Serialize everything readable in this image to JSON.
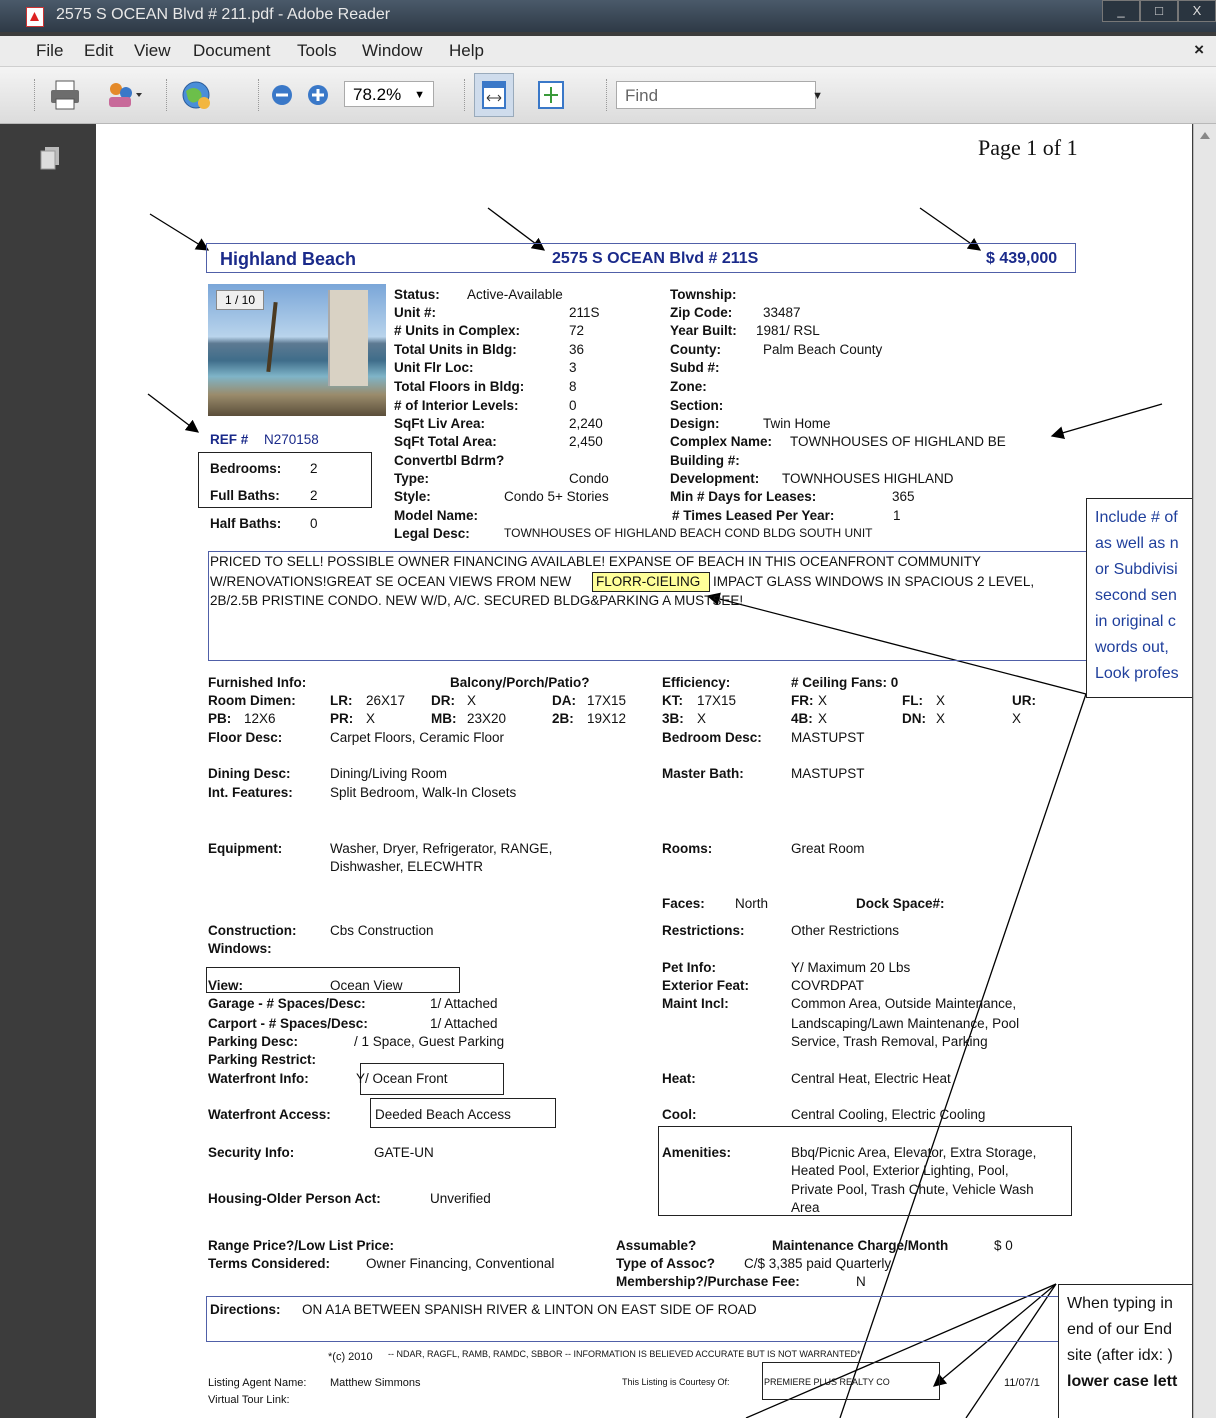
{
  "window": {
    "title": "2575 S OCEAN Blvd # 211.pdf - Adobe Reader",
    "min_label": "_",
    "max_label": "□",
    "close_label": "X"
  },
  "menu": {
    "items": [
      "File",
      "Edit",
      "View",
      "Document",
      "Tools",
      "Window",
      "Help"
    ],
    "close_label": "×"
  },
  "toolbar": {
    "zoom_value": "78.2%",
    "find_placeholder": "Find"
  },
  "icons": [
    "print-icon",
    "share-icon",
    "globe-icon",
    "zoom-out-icon",
    "zoom-in-icon",
    "fit-width-icon",
    "fit-page-icon",
    "pages-icon"
  ],
  "page": {
    "page_label": "Page 1 of 1",
    "header": {
      "city": "Highland Beach",
      "address": "2575 S OCEAN Blvd # 211S",
      "price": "$ 439,000"
    },
    "photo_counter": "1 / 10",
    "ref": {
      "label": "REF #",
      "value": "N270158"
    },
    "rooms": {
      "bed_label": "Bedrooms:",
      "bed_value": "2",
      "fbath_label": "Full Baths:",
      "fbath_value": "2",
      "hbath_label": "Half Baths:",
      "hbath_value": "0"
    },
    "left_fields": [
      {
        "label": "Status:",
        "value": "Active-Available"
      },
      {
        "label": "Unit #:",
        "value": "211S"
      },
      {
        "label": "# Units in Complex:",
        "value": "72"
      },
      {
        "label": "Total Units in Bldg:",
        "value": "36"
      },
      {
        "label": "Unit Flr Loc:",
        "value": "3"
      },
      {
        "label": "Total Floors in Bldg:",
        "value": "8"
      },
      {
        "label": "# of Interior Levels:",
        "value": "0"
      },
      {
        "label": "SqFt Liv Area:",
        "value": "2,240"
      },
      {
        "label": "SqFt Total Area:",
        "value": "2,450"
      },
      {
        "label": "Convertbl Bdrm?",
        "value": ""
      },
      {
        "label": "Type:",
        "value": "Condo"
      },
      {
        "label": "Style:",
        "value": "Condo 5+ Stories"
      },
      {
        "label": "Model Name:",
        "value": ""
      },
      {
        "label": "Legal Desc:",
        "value": "TOWNHOUSES OF HIGHLAND BEACH COND BLDG SOUTH UNIT"
      }
    ],
    "right_fields": [
      {
        "label": "Township:",
        "value": ""
      },
      {
        "label": "Zip Code:",
        "value": "33487"
      },
      {
        "label": "Year Built:",
        "value": "1981/ RSL"
      },
      {
        "label": "County:",
        "value": "Palm Beach County"
      },
      {
        "label": "Subd #:",
        "value": ""
      },
      {
        "label": "Zone:",
        "value": ""
      },
      {
        "label": "Section:",
        "value": ""
      },
      {
        "label": "Design:",
        "value": "Twin Home"
      },
      {
        "label": "Complex Name:",
        "value": "TOWNHOUSES OF HIGHLAND BE"
      },
      {
        "label": "Building #:",
        "value": ""
      },
      {
        "label": "Development:",
        "value": "TOWNHOUSES HIGHLAND"
      },
      {
        "label": "Min # Days for Leases:",
        "value": "365"
      },
      {
        "label": "# Times Leased Per Year:",
        "value": "1"
      }
    ],
    "remarks": {
      "line1": "PRICED TO SELL! POSSIBLE OWNER FINANCING AVAILABLE! EXPANSE OF BEACH IN THIS OCEANFRONT COMMUNITY",
      "line2a": "W/RENOVATIONS!GREAT SE OCEAN VIEWS FROM NEW",
      "line2hl": "FLORR-CIELING",
      "line2b": "IMPACT GLASS WINDOWS IN SPACIOUS 2 LEVEL,",
      "line3": "2B/2.5B PRISTINE CONDO. NEW W/D, A/C. SECURED BLDG&PARKING A MUSTSEE!"
    },
    "details": {
      "furnished": "Furnished Info:",
      "balcony": "Balcony/Porch/Patio?",
      "efficiency": "Efficiency:",
      "ceiling_fans": "# Ceiling Fans: 0",
      "room_dimen": "Room Dimen:",
      "lr": "LR:",
      "lr_v": "26X17",
      "dr": "DR:",
      "dr_v": "X",
      "da": "DA:",
      "da_v": "17X15",
      "kt": "KT:",
      "kt_v": "17X15",
      "fr": "FR:",
      "fr_v": "X",
      "fl": "FL:",
      "fl_v": "X",
      "ur": "UR:",
      "ur_v": "X",
      "pb": "PB:",
      "pb_v": "12X6",
      "pr": "PR:",
      "pr_v": "X",
      "mb": "MB:",
      "mb_v": "23X20",
      "b2": "2B:",
      "b2_v": "19X12",
      "b3": "3B:",
      "b3_v": "X",
      "b4": "4B:",
      "b4_v": "X",
      "dn": "DN:",
      "dn_v": "X",
      "floor_desc": "Floor Desc:",
      "floor_desc_v": "Carpet Floors, Ceramic Floor",
      "bedroom_desc": "Bedroom Desc:",
      "bedroom_desc_v": "MASTUPST",
      "dining_desc": "Dining Desc:",
      "dining_desc_v": "Dining/Living Room",
      "master_bath": "Master Bath:",
      "master_bath_v": "MASTUPST",
      "int_features": "Int. Features:",
      "int_features_v": "Split Bedroom, Walk-In Closets",
      "equipment": "Equipment:",
      "equipment_v1": "Washer, Dryer, Refrigerator, RANGE,",
      "equipment_v2": "Dishwasher, ELECWHTR",
      "rooms": "Rooms:",
      "rooms_v": "Great Room",
      "faces": "Faces:",
      "faces_v": "North",
      "dock": "Dock Space#:",
      "construction": "Construction:",
      "construction_v": "Cbs Construction",
      "restrictions": "Restrictions:",
      "restrictions_v": "Other Restrictions",
      "windows": "Windows:",
      "pet": "Pet Info:",
      "pet_v": "Y/ Maximum 20 Lbs",
      "view": "View:",
      "view_v": "Ocean View",
      "exterior": "Exterior Feat:",
      "exterior_v": "COVRDPAT",
      "garage": "Garage - # Spaces/Desc:",
      "garage_v": "1/ Attached",
      "maint": "Maint Incl:",
      "maint_v1": "Common Area, Outside Maintenance,",
      "maint_v2": "Landscaping/Lawn Maintenance, Pool",
      "maint_v3": "Service, Trash Removal, Parking",
      "carport": "Carport - # Spaces/Desc:",
      "carport_v": "1/ Attached",
      "parking_desc": "Parking Desc:",
      "parking_desc_v": "/ 1 Space, Guest Parking",
      "parking_restrict": "Parking Restrict:",
      "waterfront_info": "Waterfront Info:",
      "waterfront_info_v": "Y/ Ocean Front",
      "heat": "Heat:",
      "heat_v": "Central Heat, Electric Heat",
      "waterfront_access": "Waterfront Access:",
      "waterfront_access_v": "Deeded Beach Access",
      "cool": "Cool:",
      "cool_v": "Central Cooling, Electric Cooling",
      "security": "Security Info:",
      "security_v": "GATE-UN",
      "amenities": "Amenities:",
      "amenities_v1": "Bbq/Picnic Area, Elevator, Extra Storage,",
      "amenities_v2": "Heated Pool, Exterior Lighting, Pool,",
      "amenities_v3": "Private Pool, Trash Chute, Vehicle Wash",
      "amenities_v4": "Area",
      "housing": "Housing-Older Person Act:",
      "housing_v": "Unverified",
      "range_price": "Range Price?/Low List Price:",
      "assumable": "Assumable?",
      "maint_charge": "Maintenance Charge/Month",
      "maint_charge_v": "$ 0",
      "terms": "Terms Considered:",
      "terms_v": "Owner Financing, Conventional",
      "type_assoc": "Type of Assoc?",
      "type_assoc_v": "C/$ 3,385 paid Quarterly",
      "membership": "Membership?/Purchase Fee:",
      "membership_v": "N"
    },
    "directions": {
      "label": "Directions:",
      "value": "ON A1A BETWEEN SPANISH RIVER & LINTON ON EAST SIDE OF ROAD"
    },
    "footer": {
      "copyright": "*(c) 2010",
      "disclaimer": "-- NDAR, RAGFL, RAMB, RAMDC, SBBOR -- INFORMATION IS BELIEVED ACCURATE BUT IS NOT WARRANTED*",
      "agent_label": "Listing Agent Name:",
      "agent_value": "Matthew Simmons",
      "courtesy": "This Listing is Courtesy Of:",
      "office": "PREMIERE PLUS REALTY CO",
      "date": "11/07/1",
      "tour": "Virtual Tour Link:"
    }
  },
  "annotation1": {
    "lines": [
      "Include # of",
      "as well as n",
      "or Subdivisi",
      "second sen",
      "in original c",
      "words out,",
      "Look profes"
    ]
  },
  "annotation2": {
    "line1": "When typing in",
    "line2": "end of our End",
    "line3": "site (after idx: )",
    "line4": "lower case lett"
  }
}
